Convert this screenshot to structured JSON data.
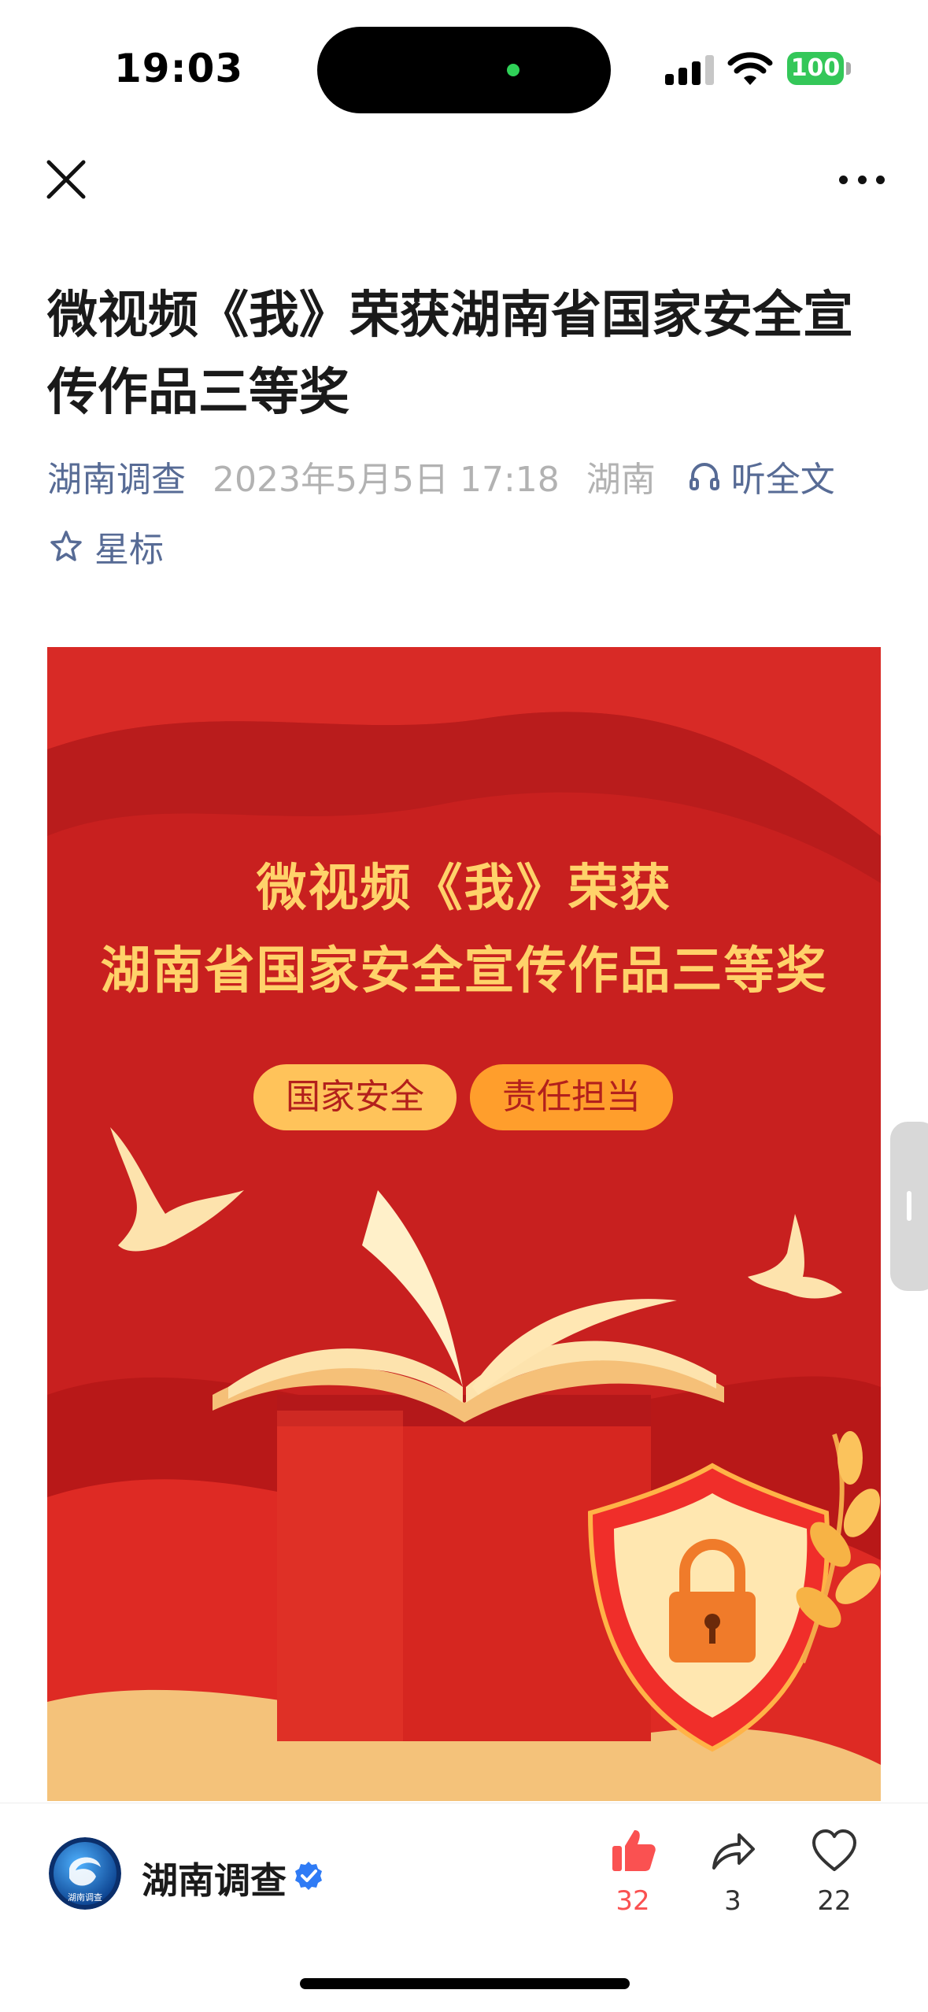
{
  "status_bar": {
    "time": "19:03",
    "battery": "100"
  },
  "article": {
    "title": "微视频《我》荣获湖南省国家安全宣传作品三等奖",
    "account": "湖南调查",
    "date": "2023年5月5日 17:18",
    "region": "湖南",
    "listen_label": "听全文",
    "star_label": "星标"
  },
  "poster": {
    "line1": "微视频《我》荣获",
    "line2": "湖南省国家安全宣传作品三等奖",
    "tags": [
      "国家安全",
      "责任担当"
    ]
  },
  "bottom_bar": {
    "account_name": "湖南调查",
    "avatar_text": "湖南调查",
    "like_count": "32",
    "share_count": "3",
    "favorite_count": "22"
  },
  "icons": {
    "close": "close-icon",
    "more": "more-icon",
    "headphones": "headphones-icon",
    "star": "star-icon",
    "verified": "verified-badge-icon",
    "like": "thumbs-up-icon",
    "share": "share-icon",
    "favorite": "heart-icon"
  },
  "colors": {
    "link": "#576b95",
    "meta_gray": "#b2b2b2",
    "poster_red": "#c8201f",
    "poster_gold": "#ffd26a",
    "like_red": "#fa5151",
    "battery_green": "#34c759"
  }
}
